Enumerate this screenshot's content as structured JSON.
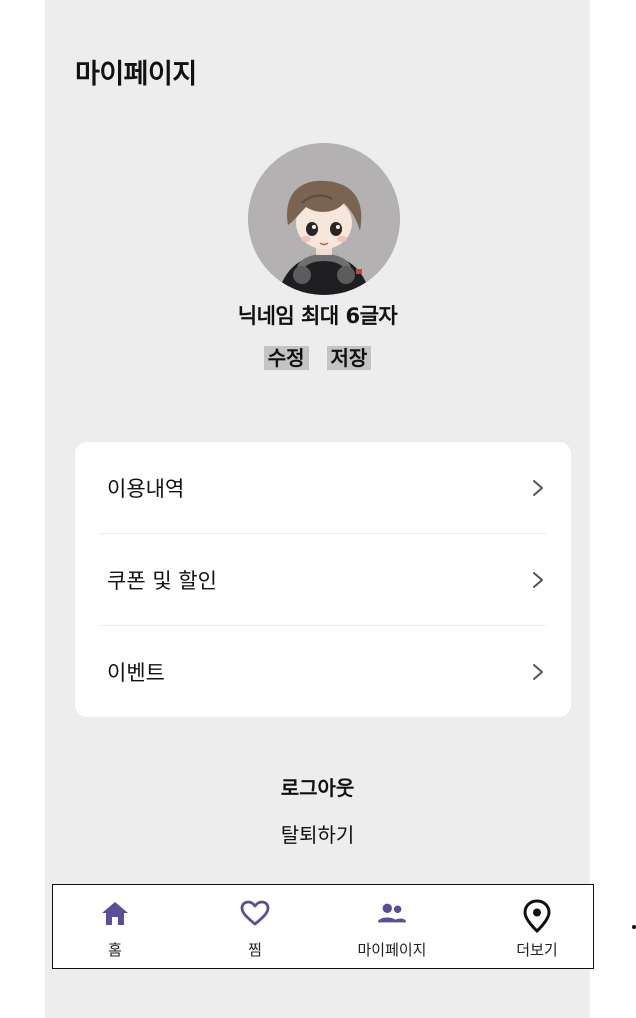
{
  "header": {
    "title": "마이페이지"
  },
  "profile": {
    "nickname": "닉네임 최대 6글자",
    "edit_label": "수정",
    "save_label": "저장"
  },
  "menu": {
    "items": [
      {
        "label": "이용내역",
        "icon": "chevron-right-icon"
      },
      {
        "label": "쿠폰 및 할인",
        "icon": "chevron-right-icon"
      },
      {
        "label": "이벤트",
        "icon": "chevron-right-icon"
      }
    ]
  },
  "account": {
    "logout_label": "로그아웃",
    "withdraw_label": "탈퇴하기"
  },
  "tabbar": {
    "accent": "#5a4e96",
    "tabs": [
      {
        "label": "홈",
        "icon": "home-icon"
      },
      {
        "label": "찜",
        "icon": "heart-icon"
      },
      {
        "label": "마이페이지",
        "icon": "people-icon"
      },
      {
        "label": "더보기",
        "icon": "map-pin-icon"
      }
    ]
  }
}
